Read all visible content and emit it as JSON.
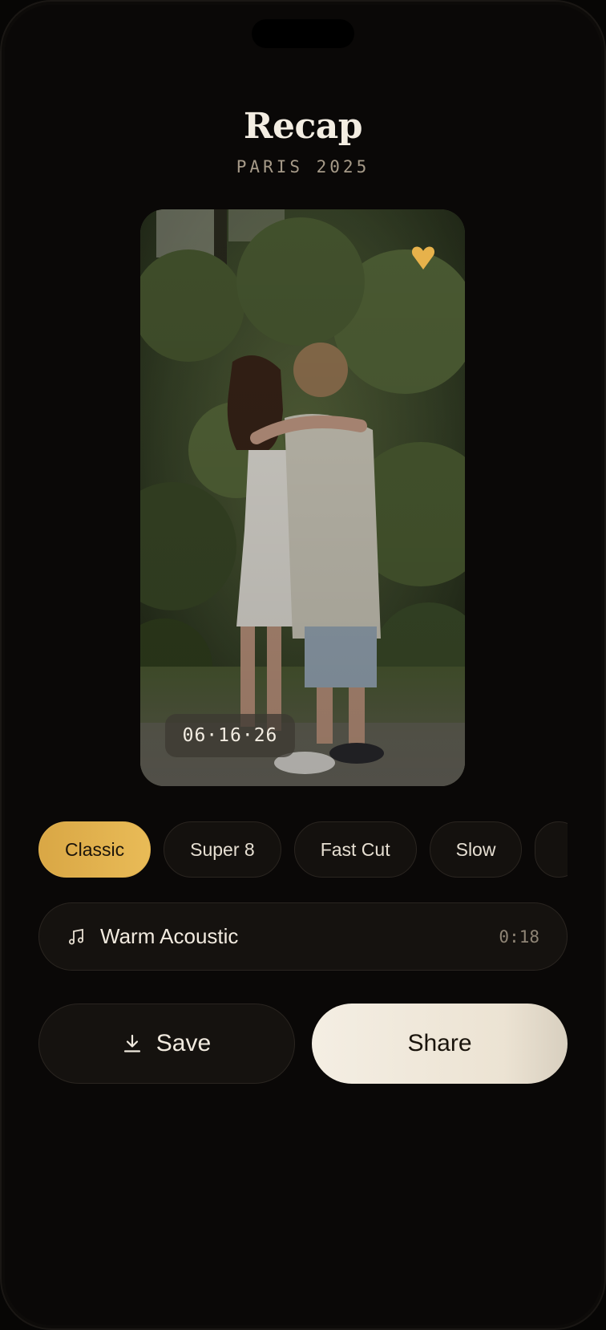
{
  "header": {
    "title": "Recap",
    "subtitle": "PARIS 2025"
  },
  "photo": {
    "date_label": "06·16·26",
    "favorite_icon": "heart-icon",
    "favorite_color": "#E7B24B",
    "favorited": true
  },
  "filters": {
    "selected": "Classic",
    "items": [
      {
        "label": "Classic",
        "active": true
      },
      {
        "label": "Super 8",
        "active": false
      },
      {
        "label": "Fast Cut",
        "active": false
      },
      {
        "label": "Slow",
        "active": false
      },
      {
        "label": "",
        "active": false
      }
    ]
  },
  "music": {
    "icon": "music-note-icon",
    "track": "Warm Acoustic",
    "duration": "0:18"
  },
  "actions": {
    "save_icon": "download-icon",
    "save_label": "Save",
    "share_label": "Share"
  },
  "colors": {
    "background": "#0A0807",
    "accent": "#E3B04E",
    "share_button": "#F2ECE1",
    "chip_bg": "#14110E"
  }
}
